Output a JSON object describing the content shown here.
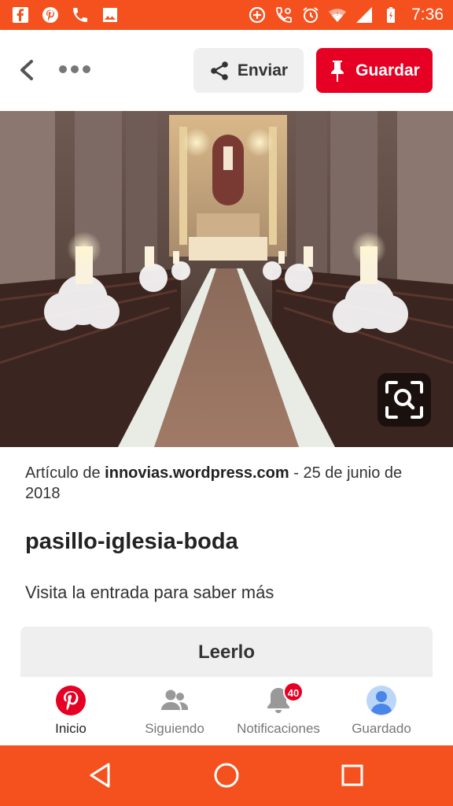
{
  "status_bar": {
    "time": "7:36",
    "left_icons": [
      "facebook-icon",
      "pinterest-icon",
      "phone-icon",
      "image-icon"
    ],
    "right_icons": [
      "add-circle-icon",
      "call-settings-icon",
      "alarm-icon",
      "wifi-icon",
      "signal-icon",
      "battery-icon"
    ],
    "color": "#f4511e"
  },
  "header": {
    "send_label": "Enviar",
    "save_label": "Guardar",
    "save_color": "#e60023"
  },
  "pin": {
    "image_description_icon": "church-aisle-image",
    "source_prefix": "Artículo de ",
    "source_site": "innovias.wordpress.com",
    "source_suffix": " - 25 de junio de 2018",
    "title": "pasillo-iglesia-boda",
    "description": "Visita la entrada para saber más",
    "read_label": "Leerlo"
  },
  "tabbar": {
    "tabs": [
      {
        "label": "Inicio",
        "icon": "pinterest-logo-icon",
        "active": true
      },
      {
        "label": "Siguiendo",
        "icon": "people-icon",
        "active": false
      },
      {
        "label": "Notificaciones",
        "icon": "bell-icon",
        "active": false
      },
      {
        "label": "Guardado",
        "icon": "avatar-icon",
        "active": false
      }
    ],
    "notification_count": "40"
  },
  "navbar": {
    "buttons": [
      "back-triangle-icon",
      "home-circle-icon",
      "recents-square-icon"
    ]
  }
}
